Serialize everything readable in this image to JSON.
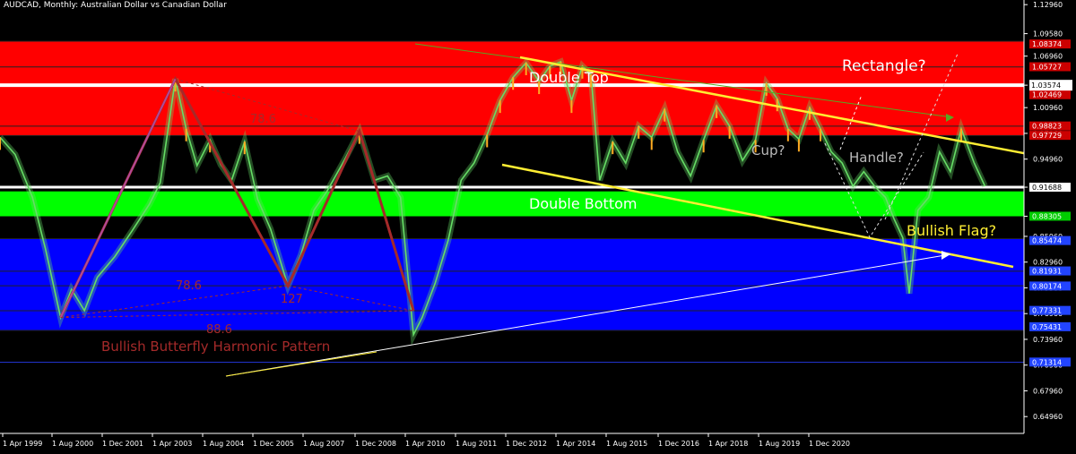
{
  "chart_data": {
    "type": "line",
    "title": "AUDCAD, Monthly:  Australian Dollar vs Canadian Dollar",
    "xlabel": "",
    "ylabel": "",
    "x_ticks": [
      "1 Apr 1999",
      "1 Aug 2000",
      "1 Dec 2001",
      "1 Apr 2003",
      "1 Aug 2004",
      "1 Dec 2005",
      "1 Aug 2007",
      "1 Dec 2008",
      "1 Apr 2010",
      "1 Aug 2011",
      "1 Dec 2012",
      "1 Apr 2014",
      "1 Aug 2015",
      "1 Dec 2016",
      "1 Apr 2018",
      "1 Aug 2019",
      "1 Dec 2020"
    ],
    "y_ticks": [
      "1.12960",
      "1.09580",
      "1.06960",
      "1.03574",
      "1.00960",
      "0.97960",
      "0.94960",
      "0.91688",
      "0.88305",
      "0.85960",
      "0.82960",
      "0.79960",
      "0.76960",
      "0.73960",
      "0.70960",
      "0.67960",
      "0.64960"
    ],
    "ylim": [
      0.63,
      1.135
    ],
    "grid": false,
    "current_price": "1.03574",
    "level_labels": [
      "1.08374",
      "1.05727",
      "1.02469",
      "0.98823",
      "0.97729",
      "0.91688",
      "0.88305",
      "0.85474",
      "0.81931",
      "0.80174",
      "0.77331",
      "0.75431",
      "0.71314"
    ],
    "zones": [
      {
        "name": "resistance",
        "from": 0.977,
        "to": 1.087,
        "color": "#ff0000"
      },
      {
        "name": "support",
        "from": 0.883,
        "to": 0.912,
        "color": "#00ff00"
      },
      {
        "name": "demand",
        "from": 0.75,
        "to": 0.857,
        "color": "#0000ff"
      }
    ],
    "series": [
      {
        "values": [
          [
            1999.25,
            0.975
          ],
          [
            1999.6,
            0.955
          ],
          [
            2000.0,
            0.905
          ],
          [
            2000.3,
            0.845
          ],
          [
            2000.65,
            0.765
          ],
          [
            2000.9,
            0.798
          ],
          [
            2001.2,
            0.773
          ],
          [
            2001.5,
            0.812
          ],
          [
            2001.9,
            0.836
          ],
          [
            2002.3,
            0.866
          ],
          [
            2002.7,
            0.897
          ],
          [
            2002.95,
            0.922
          ],
          [
            2003.3,
            1.043
          ],
          [
            2003.55,
            0.985
          ],
          [
            2003.8,
            0.942
          ],
          [
            2004.1,
            0.972
          ],
          [
            2004.35,
            0.943
          ],
          [
            2004.6,
            0.925
          ],
          [
            2004.9,
            0.97
          ],
          [
            2005.2,
            0.903
          ],
          [
            2005.5,
            0.868
          ],
          [
            2005.9,
            0.802
          ],
          [
            2006.2,
            0.838
          ],
          [
            2006.5,
            0.89
          ],
          [
            2006.8,
            0.912
          ],
          [
            2007.2,
            0.948
          ],
          [
            2007.55,
            0.982
          ],
          [
            2007.9,
            0.925
          ],
          [
            2008.2,
            0.93
          ],
          [
            2008.5,
            0.905
          ],
          [
            2008.8,
            0.745
          ],
          [
            2009.0,
            0.765
          ],
          [
            2009.3,
            0.805
          ],
          [
            2009.6,
            0.855
          ],
          [
            2009.9,
            0.925
          ],
          [
            2010.2,
            0.945
          ],
          [
            2010.5,
            0.978
          ],
          [
            2010.8,
            1.018
          ],
          [
            2011.1,
            1.045
          ],
          [
            2011.4,
            1.062
          ],
          [
            2011.7,
            1.04
          ],
          [
            2011.95,
            1.058
          ],
          [
            2012.2,
            1.063
          ],
          [
            2012.45,
            1.018
          ],
          [
            2012.7,
            1.058
          ],
          [
            2012.9,
            1.048
          ],
          [
            2013.1,
            0.925
          ],
          [
            2013.4,
            0.97
          ],
          [
            2013.7,
            0.945
          ],
          [
            2014.0,
            0.988
          ],
          [
            2014.3,
            0.975
          ],
          [
            2014.6,
            1.008
          ],
          [
            2014.9,
            0.958
          ],
          [
            2015.2,
            0.93
          ],
          [
            2015.5,
            0.972
          ],
          [
            2015.8,
            1.012
          ],
          [
            2016.1,
            0.988
          ],
          [
            2016.4,
            0.948
          ],
          [
            2016.7,
            0.972
          ],
          [
            2016.95,
            1.038
          ],
          [
            2017.2,
            1.02
          ],
          [
            2017.45,
            0.985
          ],
          [
            2017.7,
            0.973
          ],
          [
            2017.95,
            1.01
          ],
          [
            2018.2,
            0.985
          ],
          [
            2018.45,
            0.958
          ],
          [
            2018.7,
            0.945
          ],
          [
            2018.95,
            0.918
          ],
          [
            2019.2,
            0.935
          ],
          [
            2019.45,
            0.918
          ],
          [
            2019.7,
            0.905
          ],
          [
            2019.9,
            0.88
          ],
          [
            2020.1,
            0.858
          ],
          [
            2020.25,
            0.793
          ],
          [
            2020.45,
            0.89
          ],
          [
            2020.7,
            0.905
          ],
          [
            2020.95,
            0.958
          ],
          [
            2021.2,
            0.935
          ],
          [
            2021.45,
            0.985
          ],
          [
            2021.75,
            0.945
          ],
          [
            2022.0,
            0.918
          ]
        ]
      }
    ],
    "annotations": {
      "double_top": "Double Top",
      "rectangle": "Rectangle?",
      "cup": "Cup?",
      "handle": "Handle?",
      "double_bottom": "Double Bottom",
      "bullish_flag": "Bullish Flag?",
      "fib_78_6_upper": "78.6",
      "fib_78_6_lower": "78.6",
      "fib_127": "127",
      "fib_88_6": "88.6",
      "butterfly": "Bullish Butterfly Harmonic Pattern"
    },
    "colors": {
      "background": "#000000",
      "resistance_zone": "#ff0000",
      "support_zone": "#00ff00",
      "demand_zone": "#0000ff",
      "price_line": "#66dd66",
      "price_highlight": "#ffaa22",
      "harmonic": "#a52a2a",
      "trendline": "#ffee33",
      "label_text": "#ffffff",
      "cup_text": "#bbbbbb"
    }
  }
}
